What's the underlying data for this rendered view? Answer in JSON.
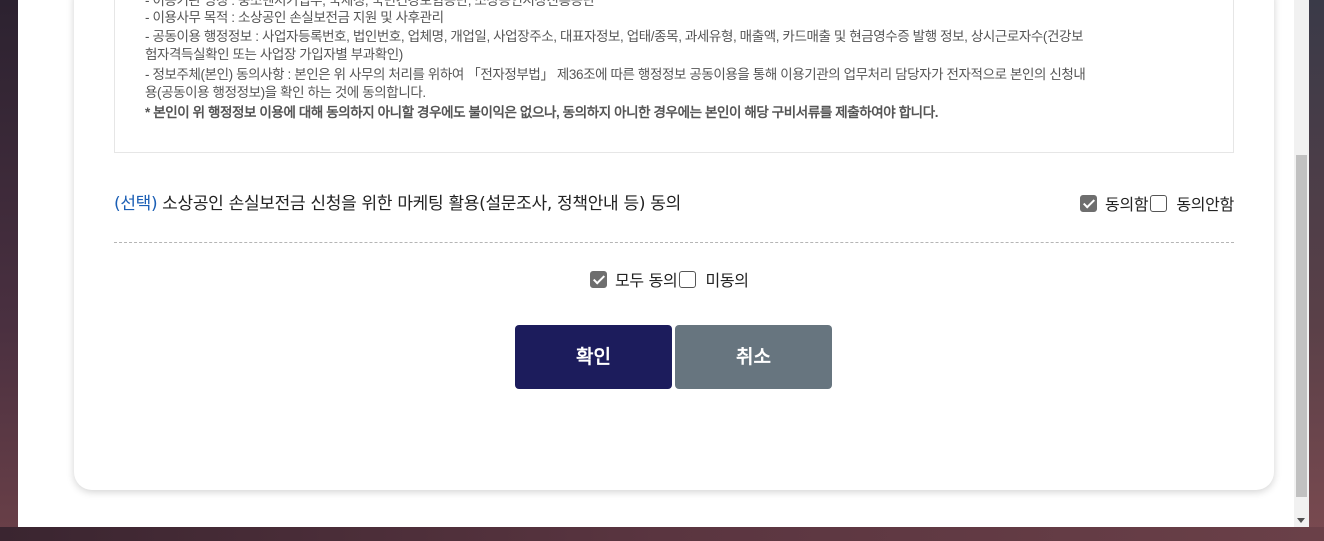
{
  "notice": {
    "lines": [
      "- 이용기관 명칭 : 중소벤처기업부, 국세청, 국민건강보험공단, 소상공인시장진흥공단",
      "- 이용사무 목적 : 소상공인 손실보전금 지원 및 사후관리",
      "- 공동이용 행정정보 : 사업자등록번호, 법인번호, 업체명, 개업일, 사업장주소, 대표자정보, 업태/종목, 과세유형, 매출액, 카드매출 및 현금영수증 발행 정보, 상시근로자수(건강보",
      "험자격득실확인 또는 사업장 가입자별 부과확인)",
      "- 정보주체(본인) 동의사항 : 본인은 위 사무의 처리를 위하여 「전자정부법」 제36조에 따른 행정정보 공동이용을 통해 이용기관의 업무처리 담당자가 전자적으로 본인의 신청내",
      "용(공동이용 행정정보)을 확인 하는 것에 동의합니다.",
      "* 본인이 위 행정정보 이용에 대해 동의하지 아니할 경우에도 불이익은 없으나, 동의하지 아니한 경우에는 본인이 해당 구비서류를 제출하여야 합니다."
    ]
  },
  "marketing": {
    "prefix": "(선택)",
    "title": "소상공인 손실보전금 신청을 위한 마케팅 활용(설문조사, 정책안내 등) 동의",
    "agree_label": "동의함",
    "disagree_label": "동의안함",
    "agree_checked": true
  },
  "all": {
    "agree_label": "모두 동의",
    "disagree_label": "미동의",
    "agree_checked": true
  },
  "buttons": {
    "confirm": "확인",
    "cancel": "취소"
  },
  "colors": {
    "accent_prefix": "#1b5fb5",
    "confirm_bg": "#1c1c5c",
    "cancel_bg": "#67757f",
    "checkbox_checked": "#6e6e6e"
  }
}
